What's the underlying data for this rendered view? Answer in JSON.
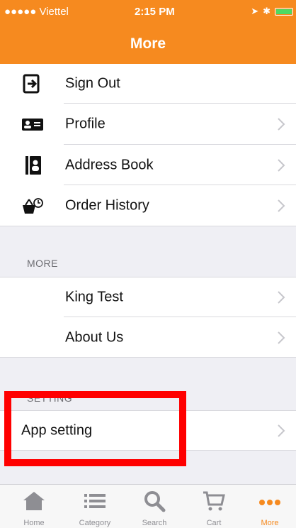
{
  "status_bar": {
    "carrier": "●●●●● Viettel",
    "time": "2:15 PM"
  },
  "nav": {
    "title": "More"
  },
  "account_items": [
    {
      "label": "Sign Out",
      "icon": "sign-out-icon"
    },
    {
      "label": "Profile",
      "icon": "profile-card-icon"
    },
    {
      "label": "Address Book",
      "icon": "address-book-icon"
    },
    {
      "label": "Order History",
      "icon": "basket-clock-icon"
    }
  ],
  "more_section": {
    "header": "MORE",
    "items": [
      {
        "label": "King Test"
      },
      {
        "label": "About Us"
      }
    ]
  },
  "setting_section": {
    "header": "SETTING",
    "items": [
      {
        "label": "App setting"
      }
    ]
  },
  "tabbar": {
    "items": [
      {
        "label": "Home",
        "icon": "home-icon"
      },
      {
        "label": "Category",
        "icon": "list-icon"
      },
      {
        "label": "Search",
        "icon": "search-icon"
      },
      {
        "label": "Cart",
        "icon": "cart-icon"
      },
      {
        "label": "More",
        "icon": "more-dots-icon",
        "active": true
      }
    ]
  },
  "colors": {
    "accent": "#f68a1f",
    "annotation": "#ff0000"
  }
}
